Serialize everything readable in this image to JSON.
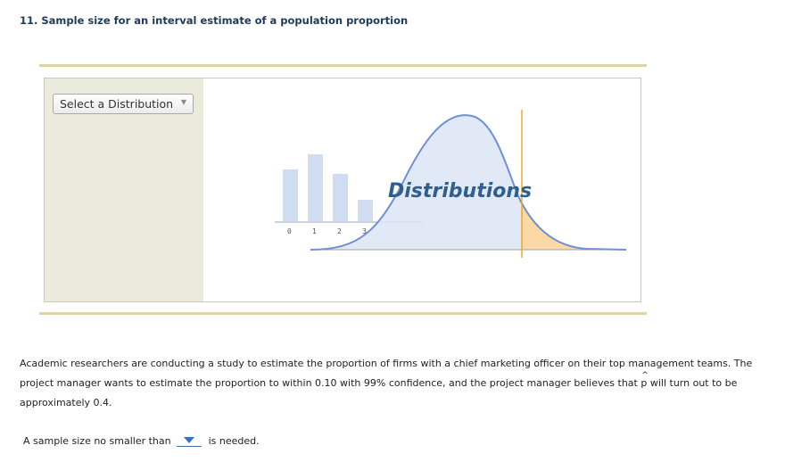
{
  "question": {
    "title": "11. Sample size for an interval estimate of a population proportion"
  },
  "tool": {
    "select_label": "Select a Distribution",
    "select_arrow_icon": "chevron-down-icon",
    "splash_text": "Distributions",
    "ticks": [
      "0",
      "1",
      "2",
      "3"
    ],
    "colors": {
      "left_panel": "#ebebdc",
      "curve": "#6f8fd6",
      "curve_fill": "#dce5f6",
      "tail_fill": "#fbd9a6",
      "marker": "#f5a623",
      "bars": "#cfdcf2",
      "rule": "#dcd4a8"
    }
  },
  "problem": {
    "text_before_phat": "Academic researchers are conducting a study to estimate the proportion of firms with a chief marketing officer on their top management teams. The project manager wants to estimate the proportion to within 0.10 with 99% confidence, and the project manager believes that ",
    "phat": "p",
    "text_after_phat": " will turn out to be approximately 0.4."
  },
  "answer": {
    "prefix": "A sample size no smaller than",
    "selected_value": "",
    "suffix": "is needed."
  }
}
